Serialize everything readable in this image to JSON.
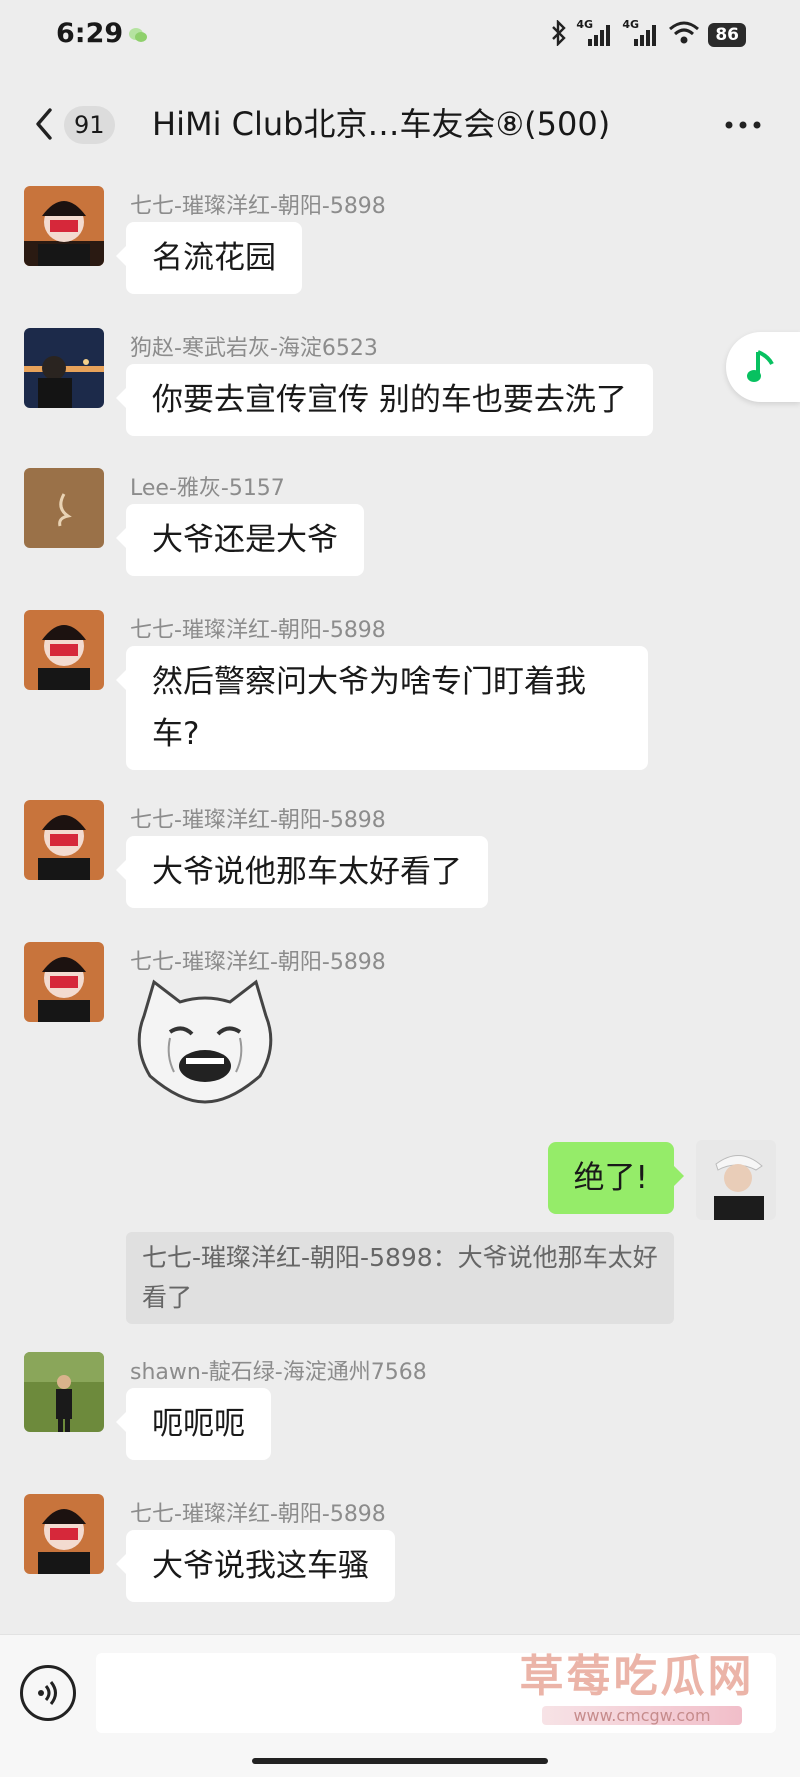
{
  "status": {
    "time": "6:29",
    "network_1": "4G",
    "network_2": "4G",
    "battery": "86"
  },
  "header": {
    "unread_count": "91",
    "title": "HiMi Club北京…车友会⑧(500)"
  },
  "messages": [
    {
      "sender": "七七-璀璨洋红-朝阳-5898",
      "text": "名流花园"
    },
    {
      "sender": "狗赵-寒武岩灰-海淀6523",
      "text": "你要去宣传宣传 别的车也要去洗了"
    },
    {
      "sender": "Lee-雅灰-5157",
      "text": "大爷还是大爷"
    },
    {
      "sender": "七七-璀璨洋红-朝阳-5898",
      "text": "然后警察问大爷为啥专门盯着我车?"
    },
    {
      "sender": "七七-璀璨洋红-朝阳-5898",
      "text": "大爷说他那车太好看了"
    },
    {
      "sender": "七七-璀璨洋红-朝阳-5898",
      "sticker": "crying-cat-sticker"
    },
    {
      "sender": "me",
      "text": "绝了!",
      "quote": "七七-璀璨洋红-朝阳-5898：大爷说他那车太好看了"
    },
    {
      "sender": "shawn-靛石绿-海淀通州7568",
      "text": "呃呃呃"
    },
    {
      "sender": "七七-璀璨洋红-朝阳-5898",
      "text": "大爷说我这车骚"
    }
  ],
  "watermark": {
    "title": "草莓吃瓜网",
    "url": "www.cmcgw.com"
  },
  "colors": {
    "background": "#ededed",
    "my_bubble": "#95ec69",
    "other_bubble": "#ffffff",
    "music_icon": "#07c160"
  }
}
